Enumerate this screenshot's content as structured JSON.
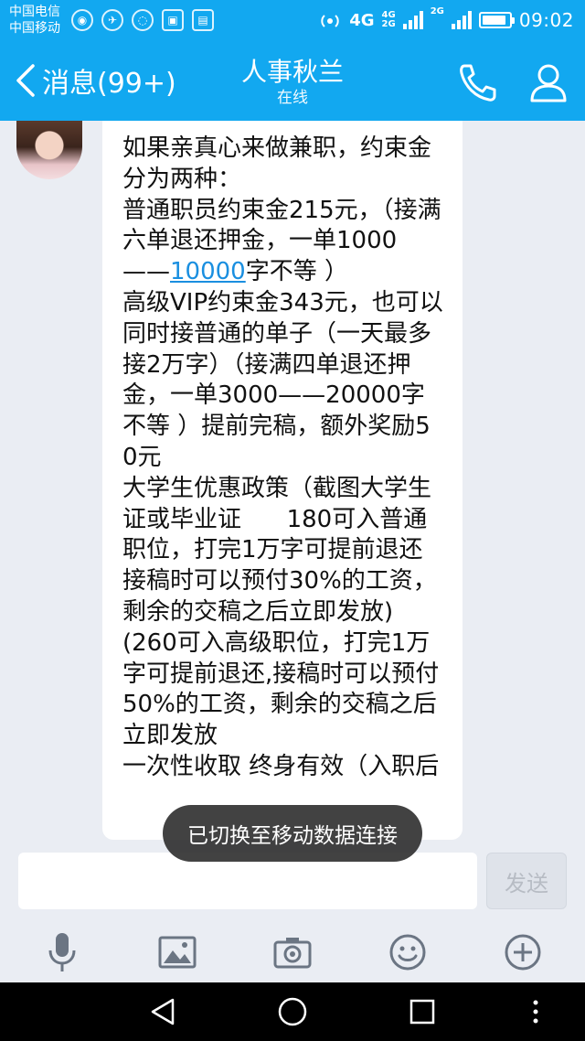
{
  "status_bar": {
    "carrier_1": "中国电信",
    "carrier_2": "中国移动",
    "network_label": "4G",
    "sim1_network": "4G",
    "sim2_network": "2G",
    "sim3_network": "2G",
    "time": "09:02",
    "battery_level": 0.9
  },
  "header": {
    "back_label": "消息(99+)",
    "contact_name": "人事秋兰",
    "contact_status": "在线"
  },
  "message": {
    "text_before_link": "如果亲真心来做兼职，约束金分为两种：\n普通职员约束金215元，（接满六单退还押金，一单1000——",
    "link_text": "10000",
    "text_after_link": "字不等 ）\n高级VIP约束金343元，也可以同时接普通的单子（一天最多接2万字）（接满四单退还押金，一单3000——20000字不等 ）提前完稿，额外奖励50元\n大学生优惠政策（截图大学生证或毕业证      180可入普通职位，打完1万字可提前退还接稿时可以预付30%的工资，剩余的交稿之后立即发放)      (260可入高级职位，打完1万字可提前退还,接稿时可以预付50%的工资，剩余的交稿之后立即发放\n一次性收取 终身有效（入职后"
  },
  "toast": "已切换至移动数据连接",
  "input": {
    "value": "",
    "placeholder": "",
    "send_label": "发送"
  },
  "toolbar_icons": [
    "microphone-icon",
    "image-icon",
    "camera-icon",
    "emoji-icon",
    "plus-icon"
  ],
  "colors": {
    "accent": "#12a8f0",
    "link": "#1a8fe0",
    "background": "#eaedf3"
  }
}
